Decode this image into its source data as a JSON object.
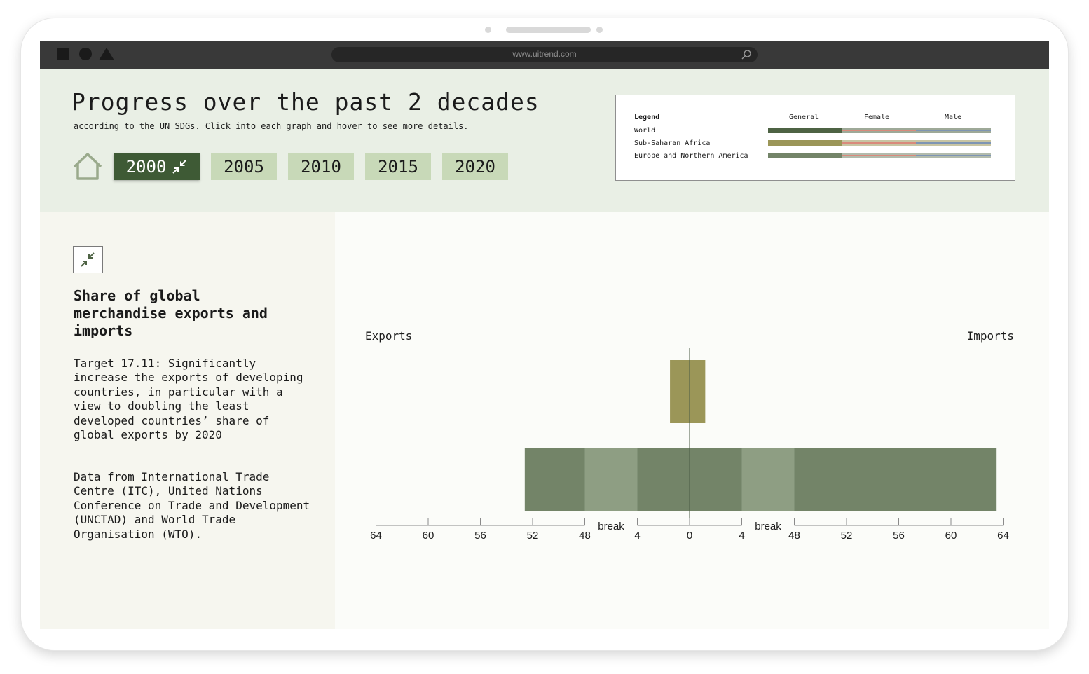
{
  "browser": {
    "url": "www.uitrend.com"
  },
  "header": {
    "title": "Progress over the past 2 decades",
    "subtitle": "according to the UN SDGs. Click into each graph and hover to see more details.",
    "years": [
      {
        "label": "2000",
        "active": true
      },
      {
        "label": "2005",
        "active": false
      },
      {
        "label": "2010",
        "active": false
      },
      {
        "label": "2015",
        "active": false
      },
      {
        "label": "2020",
        "active": false
      }
    ]
  },
  "legend": {
    "title": "Legend",
    "columns": [
      "General",
      "Female",
      "Male"
    ],
    "rows": [
      {
        "label": "World",
        "color": "#4e6344"
      },
      {
        "label": "Sub-Saharan Africa",
        "color": "#9b9658"
      },
      {
        "label": "Europe and Northern America",
        "color": "#738468"
      }
    ],
    "female_color": "#d98a7c",
    "male_color": "#7e95b4"
  },
  "panel": {
    "title": "Share of global merchandise exports and imports",
    "target": "Target 17.11: Significantly increase the exports of developing countries, in particular with a view to doubling the least developed countries’ share of global exports by 2020",
    "source": "Data from International Trade Centre (ITC), United Nations Conference on Trade and Development (UNCTAD) and World Trade Organisation (WTO)."
  },
  "chart_data": {
    "type": "bar",
    "left_label": "Exports",
    "right_label": "Imports",
    "axis_ticks": [
      "64",
      "60",
      "56",
      "52",
      "48",
      "break",
      "4",
      "0",
      "4",
      "break",
      "48",
      "52",
      "56",
      "60",
      "64"
    ],
    "axis_segments": {
      "outer": [
        48,
        64
      ],
      "inner": [
        0,
        4
      ]
    },
    "series": [
      {
        "region": "Sub-Saharan Africa",
        "exports": 1.5,
        "imports": 1.2,
        "color": "#9b9658"
      },
      {
        "region": "Europe and Northern America",
        "exports": 52.6,
        "imports": 63.5,
        "color": "#738468"
      }
    ],
    "break_color": "#8e9e83"
  }
}
